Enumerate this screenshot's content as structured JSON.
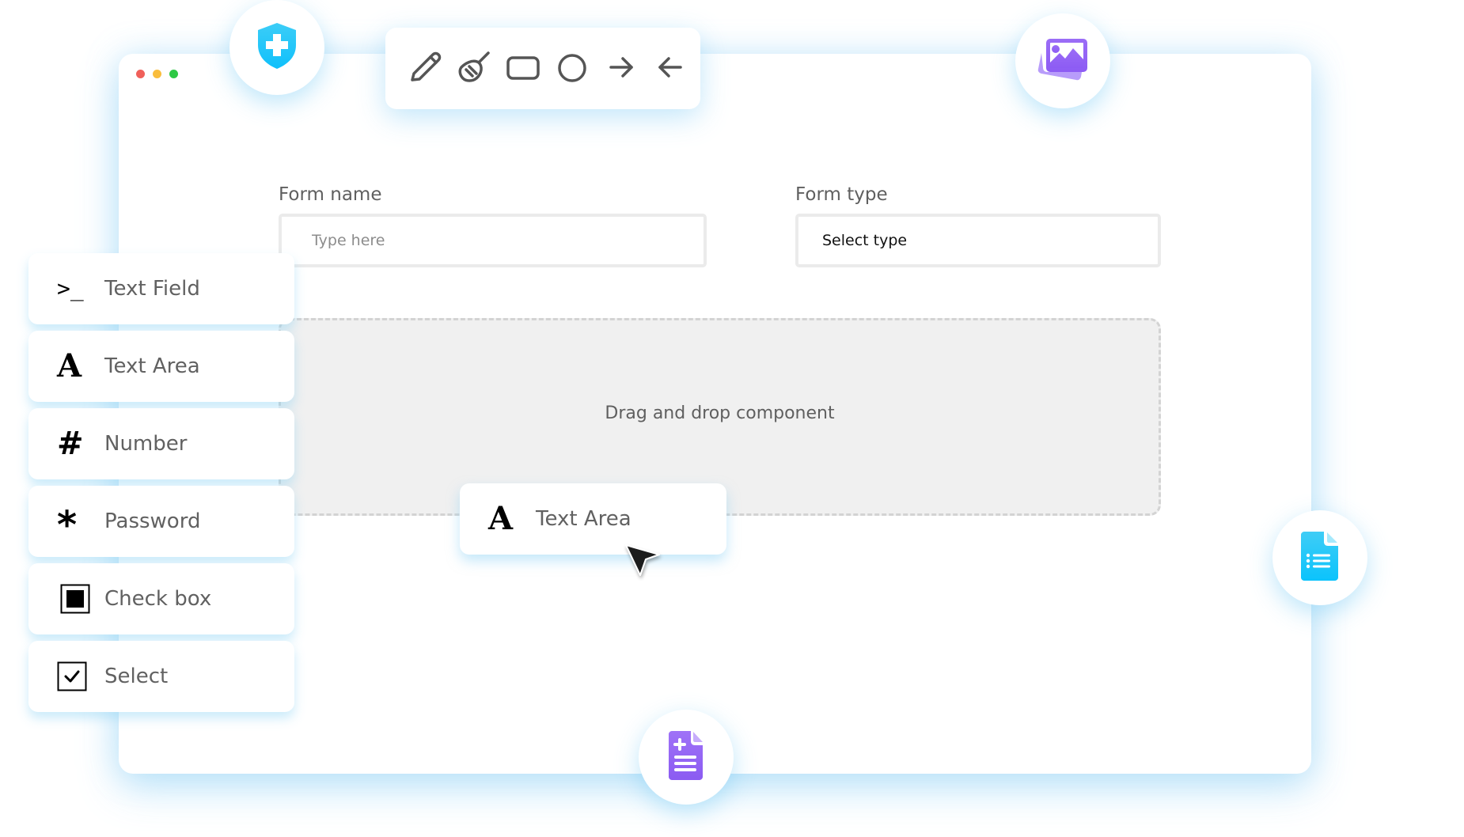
{
  "window": {
    "controls": [
      "close",
      "minimize",
      "maximize"
    ],
    "control_colors": {
      "close": "#f0605a",
      "minimize": "#f9bd3d",
      "maximize": "#2ec845"
    }
  },
  "floating_icons": {
    "shield": {
      "icon": "shield-plus-icon",
      "color": "#1ec2f8"
    },
    "images": {
      "icon": "image-gallery-icon",
      "color": "#9366f5"
    },
    "document_list": {
      "icon": "document-list-icon",
      "color": "#12c4fb"
    },
    "document_add": {
      "icon": "document-add-icon",
      "color": "#9366f5"
    }
  },
  "toolbar": {
    "tools": [
      {
        "name": "pencil",
        "icon": "pencil-icon"
      },
      {
        "name": "eraser",
        "icon": "broom-icon"
      },
      {
        "name": "rectangle",
        "icon": "rectangle-icon"
      },
      {
        "name": "circle",
        "icon": "circle-icon"
      },
      {
        "name": "arrow-right",
        "icon": "arrow-right-icon"
      },
      {
        "name": "arrow-left",
        "icon": "arrow-left-icon"
      }
    ],
    "icon_color": "#555555"
  },
  "form": {
    "name_label": "Form name",
    "name_placeholder": "Type here",
    "name_value": "",
    "type_label": "Form type",
    "type_value": "Select type"
  },
  "dropzone": {
    "text": "Drag and drop component"
  },
  "components": [
    {
      "label": "Text Field",
      "icon": "terminal-prompt-icon",
      "glyph": ">_"
    },
    {
      "label": "Text Area",
      "icon": "letter-a-icon",
      "glyph": "A"
    },
    {
      "label": "Number",
      "icon": "hash-icon",
      "glyph": "#"
    },
    {
      "label": "Password",
      "icon": "asterisk-icon",
      "glyph": "*"
    },
    {
      "label": "Check box",
      "icon": "filled-square-icon",
      "glyph": ""
    },
    {
      "label": "Select",
      "icon": "checkbox-checked-icon",
      "glyph": ""
    }
  ],
  "dragged_component": {
    "label": "Text Area",
    "icon": "letter-a-icon",
    "glyph": "A"
  }
}
